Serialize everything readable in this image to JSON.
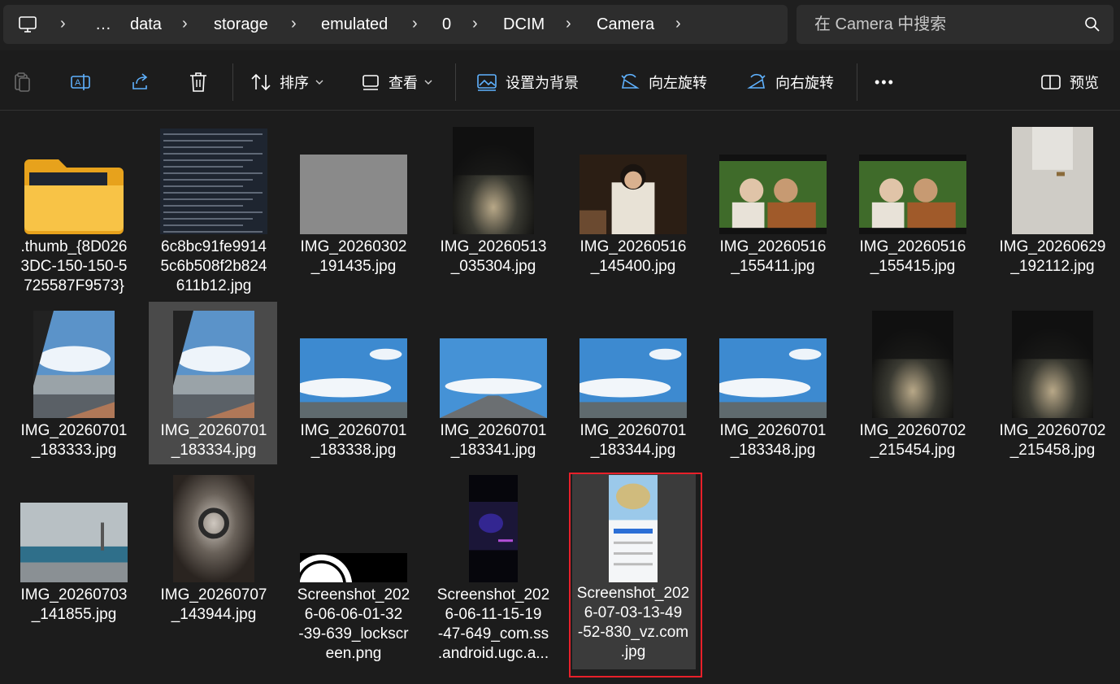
{
  "breadcrumb": {
    "items": [
      "…",
      "data",
      "storage",
      "emulated",
      "0",
      "DCIM",
      "Camera"
    ],
    "separator": "›"
  },
  "search": {
    "placeholder": "在 Camera 中搜索"
  },
  "toolbar": {
    "sort_label": "排序",
    "view_label": "查看",
    "set_bg_label": "设置为背景",
    "rotate_left_label": "向左旋转",
    "rotate_right_label": "向右旋转",
    "more_label": "•••",
    "preview_label": "预览"
  },
  "files": [
    {
      "name": ".thumb_{8D0263DC-150-150-5725587F9573}",
      "kind": "folder"
    },
    {
      "name": "6c8bc91fe99145c6b508f2b824611b12.jpg",
      "kind": "text-image"
    },
    {
      "name": "IMG_20260302_191435.jpg",
      "kind": "gray"
    },
    {
      "name": "IMG_20260513_035304.jpg",
      "kind": "night-road"
    },
    {
      "name": "IMG_20260516_145400.jpg",
      "kind": "portrait"
    },
    {
      "name": "IMG_20260516_155411.jpg",
      "kind": "elders"
    },
    {
      "name": "IMG_20260516_155415.jpg",
      "kind": "elders"
    },
    {
      "name": "IMG_20260629_192112.jpg",
      "kind": "wall"
    },
    {
      "name": "IMG_20260701_183333.jpg",
      "kind": "car-window"
    },
    {
      "name": "IMG_20260701_183334.jpg",
      "kind": "car-window"
    },
    {
      "name": "IMG_20260701_183338.jpg",
      "kind": "sky"
    },
    {
      "name": "IMG_20260701_183341.jpg",
      "kind": "sky-road"
    },
    {
      "name": "IMG_20260701_183344.jpg",
      "kind": "sky"
    },
    {
      "name": "IMG_20260701_183348.jpg",
      "kind": "sky"
    },
    {
      "name": "IMG_20260702_215454.jpg",
      "kind": "night-road"
    },
    {
      "name": "IMG_20260702_215458.jpg",
      "kind": "night-road"
    },
    {
      "name": "IMG_20260703_141855.jpg",
      "kind": "airport"
    },
    {
      "name": "IMG_20260707_143944.jpg",
      "kind": "blur"
    },
    {
      "name": "Screenshot_2026-06-06-01-32-39-639_lockscreen.png",
      "kind": "lockscreen"
    },
    {
      "name": "Screenshot_2026-06-11-15-19-47-649_com.ss.android.ugc.a...",
      "kind": "dark-phone"
    },
    {
      "name": "Screenshot_2026-07-03-13-49-52-830_vz.com.jpg",
      "kind": "map-phone"
    }
  ],
  "file_labels": [
    [
      ".thumb_{8D026",
      "3DC-150-150-5",
      "725587F9573}"
    ],
    [
      "6c8bc91fe9914",
      "5c6b508f2b824",
      "611b12.jpg"
    ],
    [
      "IMG_20260302",
      "_191435.jpg"
    ],
    [
      "IMG_20260513",
      "_035304.jpg"
    ],
    [
      "IMG_20260516",
      "_145400.jpg"
    ],
    [
      "IMG_20260516",
      "_155411.jpg"
    ],
    [
      "IMG_20260516",
      "_155415.jpg"
    ],
    [
      "IMG_20260629",
      "_192112.jpg"
    ],
    [
      "IMG_20260701",
      "_183333.jpg"
    ],
    [
      "IMG_20260701",
      "_183334.jpg"
    ],
    [
      "IMG_20260701",
      "_183338.jpg"
    ],
    [
      "IMG_20260701",
      "_183341.jpg"
    ],
    [
      "IMG_20260701",
      "_183344.jpg"
    ],
    [
      "IMG_20260701",
      "_183348.jpg"
    ],
    [
      "IMG_20260702",
      "_215454.jpg"
    ],
    [
      "IMG_20260702",
      "_215458.jpg"
    ],
    [
      "IMG_20260703",
      "_141855.jpg"
    ],
    [
      "IMG_20260707",
      "_143944.jpg"
    ],
    [
      "Screenshot_202",
      "6-06-06-01-32",
      "-39-639_lockscr",
      "een.png"
    ],
    [
      "Screenshot_202",
      "6-06-11-15-19",
      "-47-649_com.ss",
      ".android.ugc.a..."
    ],
    [
      "Screenshot_202",
      "6-07-03-13-49",
      "-52-830_vz.com",
      ".jpg"
    ]
  ],
  "colors": {
    "background": "#1c1c1c",
    "panel": "#2d2d2d",
    "highlight": "#e8202a",
    "accent_blue": "#4aa3ff"
  }
}
